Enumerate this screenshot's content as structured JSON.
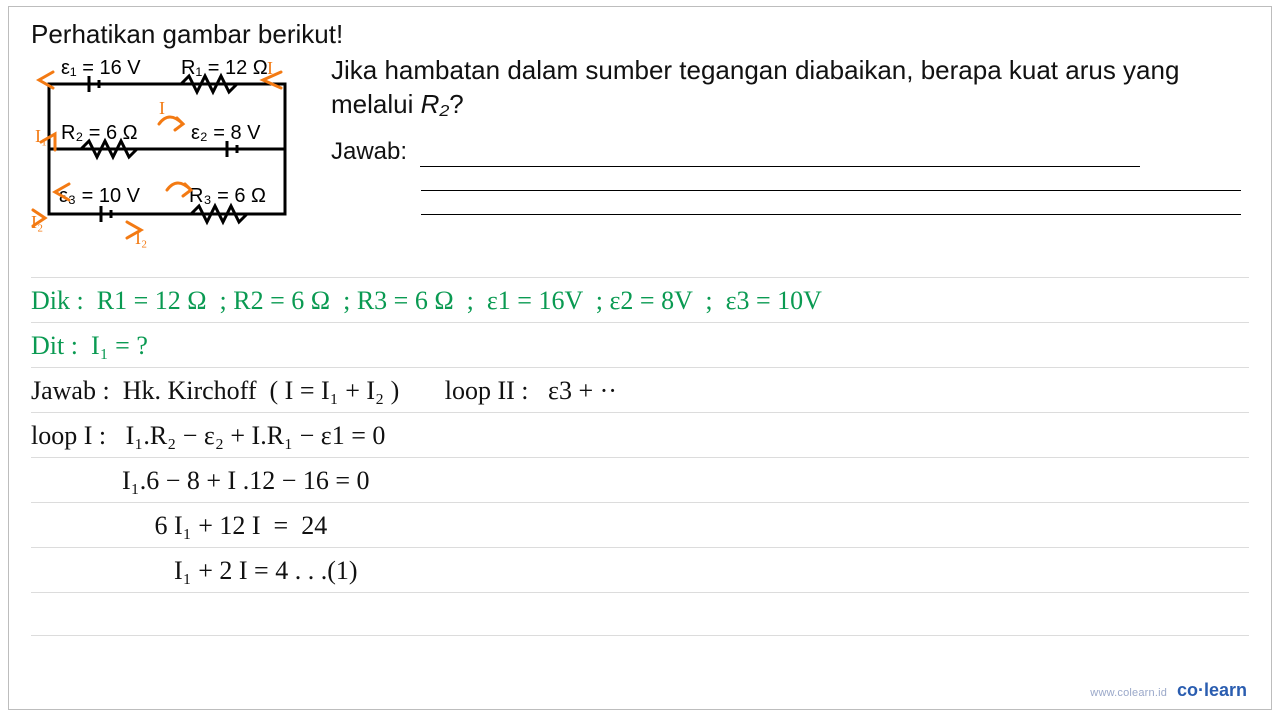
{
  "title": "Perhatikan gambar berikut!",
  "circuit": {
    "e1": "ε₁ = 16 V",
    "r1": "R₁ = 12 Ω",
    "r2": "R₂ = 6 Ω",
    "e2": "ε₂ = 8 V",
    "e3": "ε₃ = 10 V",
    "r3": "R₃ = 6 Ω",
    "annot_I": "I",
    "annot_I1": "I₁",
    "annot_I2_left": "I₂",
    "annot_I2_bottom": "I₂"
  },
  "question_line1": "Jika hambatan dalam sumber tegangan diabaikan, berapa kuat arus yang",
  "question_line2_a": "melalui ",
  "question_line2_b": "R₂",
  "question_line2_c": "?",
  "jawab_label": "Jawab:",
  "work": {
    "dik": "Dik :  R1 = 12 Ω  ; R2 = 6 Ω  ; R3 = 6 Ω  ;  ε1 = 16V  ; ε2 = 8V  ;  ε3 = 10V",
    "dit": "Dit :  I₁ = ?",
    "jawab_hdr": "Jawab :  Hk. Kirchoff  ( I = I₁ + I₂ )       loop II :   ε3 + ··",
    "loop1a": "loop I :   I₁.R₂ − ε₂ + I.R₁ − ε1 = 0",
    "loop1b": "              I₁.6 − 8 + I .12 − 16 = 0",
    "loop1c": "                   6 I₁ + 12 I  =  24",
    "loop1d": "                      I₁ + 2 I = 4 . . .(1)"
  },
  "footer_small": "www.colearn.id",
  "footer_brand": "co·learn"
}
